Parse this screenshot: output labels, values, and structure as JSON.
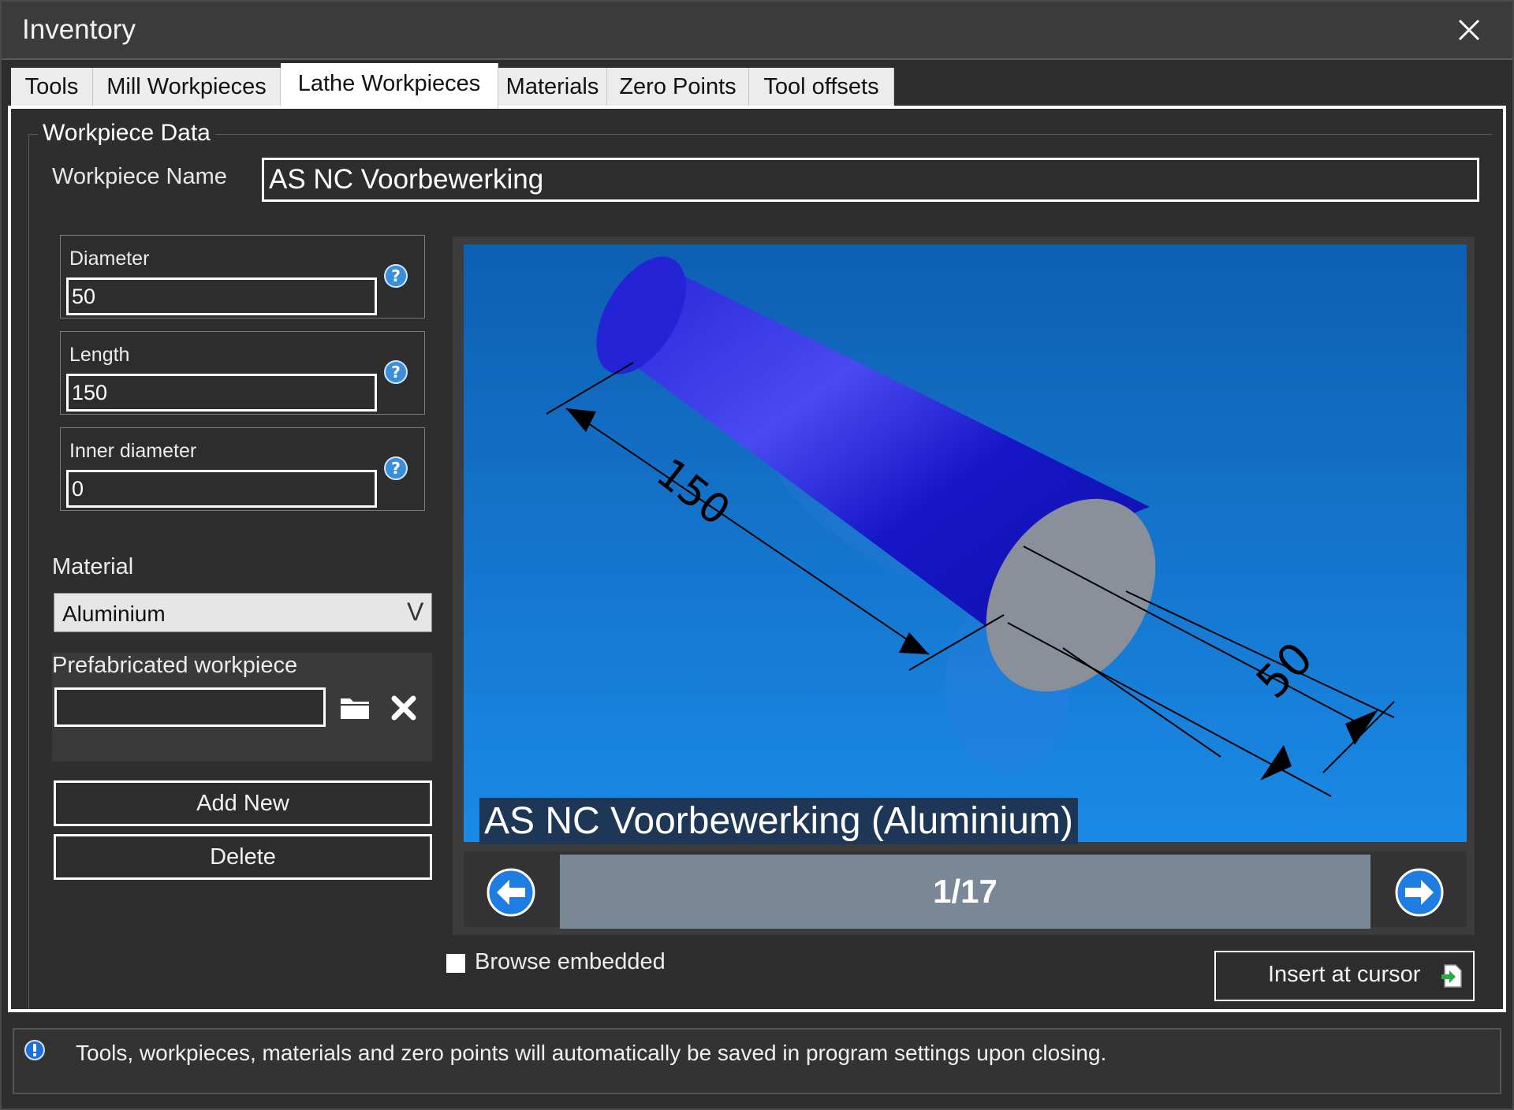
{
  "window": {
    "title": "Inventory"
  },
  "tabs": [
    {
      "label": "Tools"
    },
    {
      "label": "Mill Workpieces"
    },
    {
      "label": "Lathe Workpieces"
    },
    {
      "label": "Materials"
    },
    {
      "label": "Zero Points"
    },
    {
      "label": "Tool offsets"
    }
  ],
  "active_tab": "Lathe Workpieces",
  "group": {
    "legend": "Workpiece Data",
    "name_label": "Workpiece Name",
    "name_value": "AS NC Voorbewerking"
  },
  "fields": {
    "diameter": {
      "label": "Diameter",
      "value": "50"
    },
    "length": {
      "label": "Length",
      "value": "150"
    },
    "inner_diameter": {
      "label": "Inner diameter",
      "value": "0"
    }
  },
  "material": {
    "label": "Material",
    "value": "Aluminium",
    "arrow": "V"
  },
  "prefab": {
    "label": "Prefabricated workpiece",
    "value": ""
  },
  "buttons": {
    "add_new": "Add New",
    "delete": "Delete",
    "insert_at_cursor": "Insert at cursor"
  },
  "preview": {
    "caption": "AS NC Voorbewerking (Aluminium)",
    "dimension_length": "150",
    "dimension_diameter": "50",
    "counter": "1/17"
  },
  "browse_embedded": {
    "label": "Browse embedded",
    "checked": false
  },
  "status": {
    "message": "Tools, workpieces, materials and zero points will automatically be saved in program settings upon closing."
  },
  "colors": {
    "background": "#2d2d2d",
    "accent": "#ffffff",
    "preview_blue": "#1a4fd0",
    "nav_blue": "#1e7de0"
  },
  "icons": [
    "close-icon",
    "help-icon",
    "folder-icon",
    "clear-icon",
    "arrow-left-icon",
    "arrow-right-icon",
    "insert-document-icon",
    "info-icon"
  ]
}
